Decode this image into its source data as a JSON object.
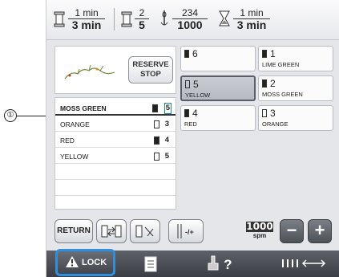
{
  "status_bar": {
    "time_remaining": {
      "top": "1 min",
      "bottom": "3 min"
    },
    "color_count": {
      "top": "2",
      "bottom": "5"
    },
    "stitch_count": {
      "top": "234",
      "bottom": "1000"
    },
    "time_to_stop": {
      "top": "1 min",
      "bottom": "3 min"
    }
  },
  "reserve_stop_label": [
    "RESERVE",
    "STOP"
  ],
  "sequence": [
    {
      "name": "MOSS GREEN",
      "number": "5",
      "spool": "dark",
      "active": true
    },
    {
      "name": "ORANGE",
      "number": "3",
      "spool": "light",
      "active": false
    },
    {
      "name": "RED",
      "number": "4",
      "spool": "dark",
      "active": false
    },
    {
      "name": "YELLOW",
      "number": "5",
      "spool": "light",
      "active": false
    }
  ],
  "thread_grid": [
    {
      "number": "6",
      "name": "",
      "selected": false,
      "spool": "dark"
    },
    {
      "number": "1",
      "name": "LIME GREEN",
      "selected": false,
      "spool": "dark"
    },
    {
      "number": "5",
      "name": "YELLOW",
      "selected": true,
      "spool": "light"
    },
    {
      "number": "2",
      "name": "MOSS GREEN",
      "selected": false,
      "spool": "dark"
    },
    {
      "number": "4",
      "name": "RED",
      "selected": false,
      "spool": "dark"
    },
    {
      "number": "3",
      "name": "ORANGE",
      "selected": false,
      "spool": "light"
    }
  ],
  "toolbar": {
    "return_label": "RETURN",
    "speed_value": "1000",
    "speed_unit": "spm",
    "minus_label": "−",
    "plus_label": "+"
  },
  "nav": {
    "lock_label": "LOCK",
    "help_label": "?"
  },
  "callout_number": "①",
  "colors": {
    "accent": "#2c8fe0",
    "nav_bg": "#4a4d53",
    "selected_cell": "#bfc2c8"
  }
}
